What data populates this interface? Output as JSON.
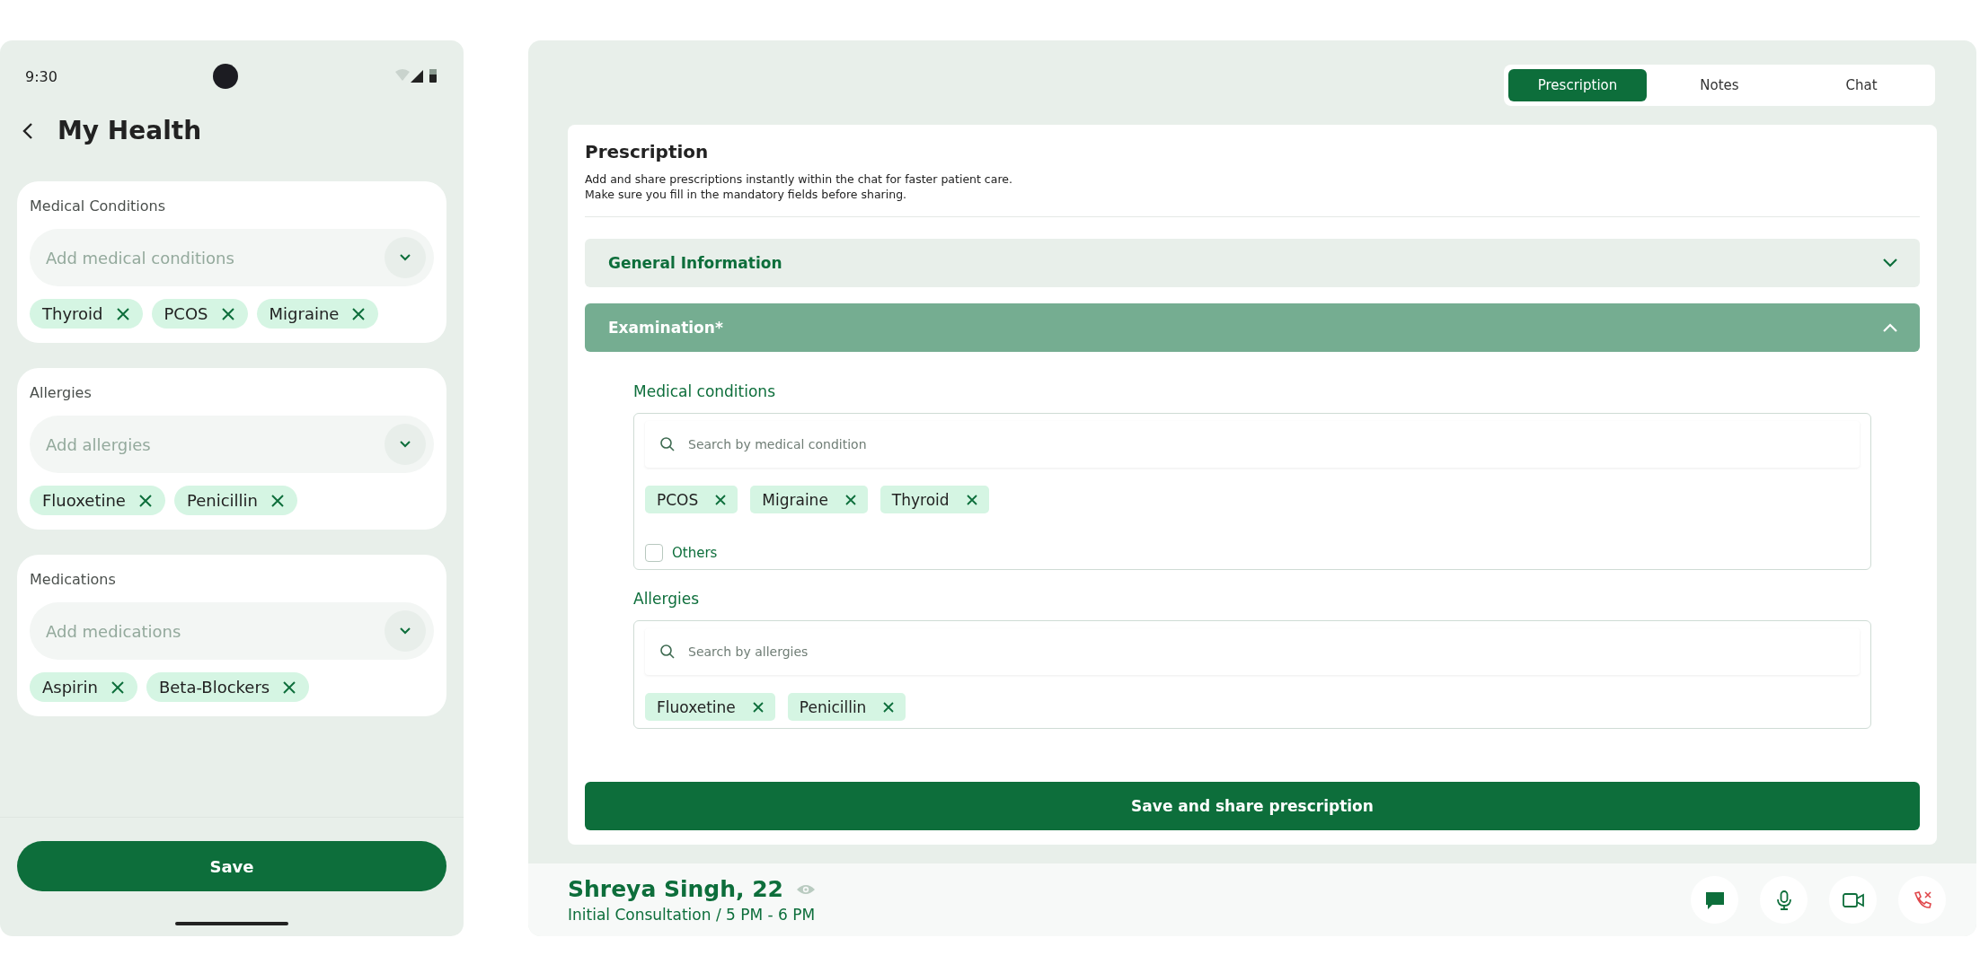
{
  "phone": {
    "status_time": "9:30",
    "title": "My Health",
    "sections": [
      {
        "label": "Medical Conditions",
        "placeholder": "Add medical conditions",
        "chips": [
          "Thyroid",
          "PCOS",
          "Migraine"
        ]
      },
      {
        "label": "Allergies",
        "placeholder": "Add allergies",
        "chips": [
          "Fluoxetine",
          "Penicillin"
        ]
      },
      {
        "label": "Medications",
        "placeholder": "Add medications",
        "chips": [
          "Aspirin",
          "Beta-Blockers"
        ]
      }
    ],
    "save_button": "Save"
  },
  "consultation": {
    "tabs": [
      {
        "label": "Prescription",
        "selected": true
      },
      {
        "label": "Notes",
        "selected": false
      },
      {
        "label": "Chat",
        "selected": false
      }
    ],
    "panel": {
      "title": "Prescription",
      "description": [
        "Add and share prescriptions instantly within the chat for faster patient care.",
        "Make sure you fill in the mandatory fields before sharing."
      ],
      "accordions": [
        {
          "title": "General Information",
          "expanded": false
        },
        {
          "title": "Examination*",
          "expanded": true
        }
      ],
      "fields": [
        {
          "label": "Medical conditions",
          "placeholder": "Search by medical condition",
          "chips": [
            "PCOS",
            "Migraine",
            "Thyroid"
          ],
          "others": {
            "label": "Others",
            "checked": false
          }
        },
        {
          "label": "Allergies",
          "placeholder": "Search by allergies",
          "chips": [
            "Fluoxetine",
            "Penicillin"
          ]
        }
      ],
      "submit": "Save and share prescription"
    },
    "patient": {
      "name": "Shreya Singh, 22",
      "subtitle": "Initial Consultation / 5 PM - 6 PM"
    }
  }
}
